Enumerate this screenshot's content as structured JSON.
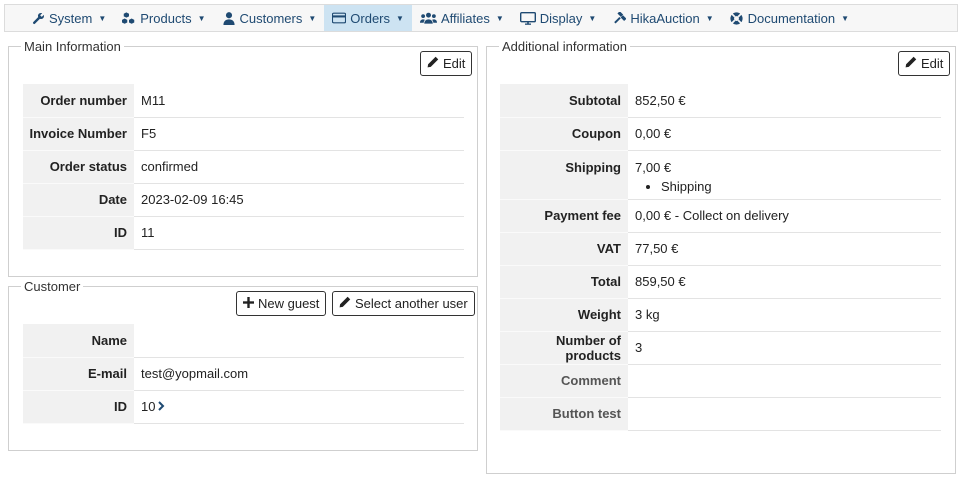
{
  "menu": {
    "items": [
      {
        "name": "menu-system",
        "icon": "wrench-icon",
        "label": "System"
      },
      {
        "name": "menu-products",
        "icon": "cubes-icon",
        "label": "Products"
      },
      {
        "name": "menu-customers",
        "icon": "user-icon",
        "label": "Customers"
      },
      {
        "name": "menu-orders",
        "icon": "credit-card-icon",
        "label": "Orders",
        "active": true
      },
      {
        "name": "menu-affiliates",
        "icon": "users-icon",
        "label": "Affiliates"
      },
      {
        "name": "menu-display",
        "icon": "monitor-icon",
        "label": "Display"
      },
      {
        "name": "menu-hikaauction",
        "icon": "gavel-icon",
        "label": "HikaAuction"
      },
      {
        "name": "menu-documentation",
        "icon": "lifebuoy-icon",
        "label": "Documentation"
      }
    ]
  },
  "main_info": {
    "legend": "Main Information",
    "edit_label": "Edit",
    "rows": [
      {
        "label": "Order number",
        "value": "M11"
      },
      {
        "label": "Invoice Number",
        "value": "F5"
      },
      {
        "label": "Order status",
        "value": "confirmed"
      },
      {
        "label": "Date",
        "value": "2023-02-09 16:45"
      },
      {
        "label": "ID",
        "value": "11"
      }
    ]
  },
  "customer": {
    "legend": "Customer",
    "new_guest_label": "New guest",
    "select_user_label": "Select another user",
    "rows": [
      {
        "label": "Name",
        "value": ""
      },
      {
        "label": "E-mail",
        "value": "test@yopmail.com"
      },
      {
        "label": "ID",
        "value": "10"
      }
    ]
  },
  "additional": {
    "legend": "Additional information",
    "edit_label": "Edit",
    "rows": [
      {
        "label": "Subtotal",
        "value": "852,50 €"
      },
      {
        "label": "Coupon",
        "value": "0,00 €"
      },
      {
        "label": "Shipping",
        "value": "7,00 €",
        "sub": "Shipping"
      },
      {
        "label": "Payment fee",
        "value": "0,00 € - Collect on delivery"
      },
      {
        "label": "VAT",
        "value": "77,50 €"
      },
      {
        "label": "Total",
        "value": "859,50 €"
      },
      {
        "label": "Weight",
        "value": "3 kg"
      },
      {
        "label": "Number of products",
        "value": "3"
      },
      {
        "label": "Comment",
        "value": ""
      },
      {
        "label": "Button test",
        "value": ""
      }
    ]
  },
  "colors": {
    "link": "#1f4a72",
    "active_menu": "#cde3f2",
    "label_bg": "#f1f1f1"
  }
}
